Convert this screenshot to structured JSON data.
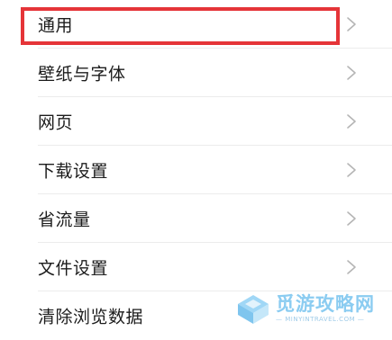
{
  "settings": {
    "items": [
      {
        "label": "通用"
      },
      {
        "label": "壁纸与字体"
      },
      {
        "label": "网页"
      },
      {
        "label": "下载设置"
      },
      {
        "label": "省流量"
      },
      {
        "label": "文件设置"
      },
      {
        "label": "清除浏览数据"
      }
    ]
  },
  "watermark": {
    "title": "觅游攻略网",
    "subtitle": "— MINYINTRAVEL.COM —"
  },
  "colors": {
    "highlight": "#e53438",
    "watermark": "#7fc7f0",
    "text": "#1c1c1c",
    "chevron": "#b5b5b5"
  }
}
